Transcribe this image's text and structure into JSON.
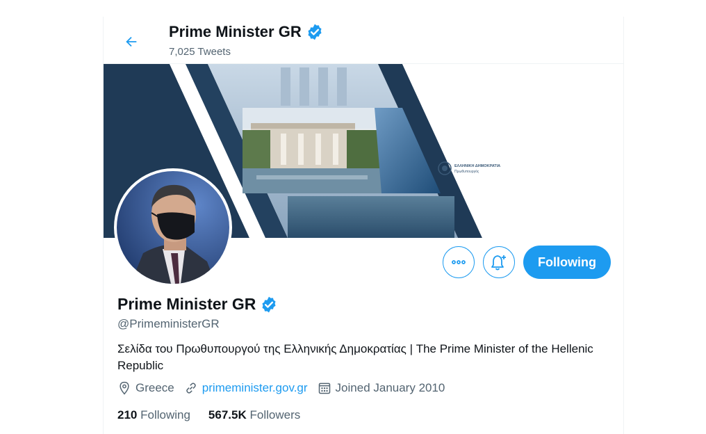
{
  "header": {
    "title": "Prime Minister GR",
    "tweet_count": "7,025 Tweets"
  },
  "banner": {
    "emblem_line1": "ΕΛΛΗΝΙΚΗ ΔΗΜΟΚΡΑΤΙΑ",
    "emblem_line2": "Πρωθυπουργός"
  },
  "profile": {
    "name": "Prime Minister GR",
    "handle": "@PrimeministerGR",
    "bio": "Σελίδα του Πρωθυπουργού της Ελληνικής Δημοκρατίας | The Prime Minister of the Hellenic Republic",
    "location": "Greece",
    "website": "primeminister.gov.gr",
    "joined": "Joined January 2010",
    "following_count": "210",
    "following_label": "Following",
    "followers_count": "567.5K",
    "followers_label": "Followers"
  },
  "actions": {
    "follow_label": "Following"
  },
  "colors": {
    "accent": "#1d9bf0",
    "banner_navy": "#1f3a56",
    "text_secondary": "#536471"
  },
  "icons": [
    "back-arrow-icon",
    "verified-badge-icon",
    "more-icon",
    "notification-bell-icon",
    "location-icon",
    "link-icon",
    "calendar-icon"
  ]
}
